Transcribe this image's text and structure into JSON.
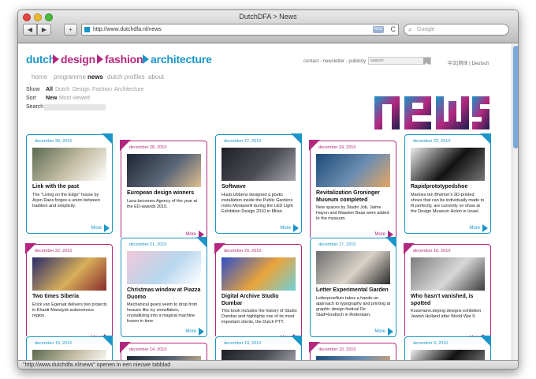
{
  "browser": {
    "window_title": "DutchDFA > News",
    "back": "◀",
    "forward": "▶",
    "add": "+",
    "url": "http://www.dutchdfa.nl/news",
    "rss": "RSS",
    "reload": "C",
    "search_placeholder": "Google",
    "status": "\"http://www.dutchdfa.nl/news\" openen in een nieuwe tabblad"
  },
  "site": {
    "sections": [
      {
        "label": "dutch",
        "color": "#1a95c8"
      },
      {
        "label": "design",
        "color": "#b3287f"
      },
      {
        "label": "fashion",
        "color": "#b3287f"
      },
      {
        "label": "architecture",
        "color": "#1a95c8"
      }
    ],
    "top_links": "contact - newsletter - publicity",
    "search_placeholder": "search",
    "lang_links": "中文|简体 | Deutsch",
    "nav": [
      "home",
      "programme",
      "news",
      "dutch profiles",
      "about"
    ],
    "nav_active": "news",
    "show_label": "Show",
    "show_options": [
      "All",
      "Dutch",
      "Design",
      "Fashion",
      "Architecture"
    ],
    "sort_label": "Sort",
    "sort_options": [
      "New",
      "Most viewed"
    ],
    "search_label": "Search",
    "logo_text": "news"
  },
  "colors": {
    "blue": "#1a95c8",
    "magenta": "#b3287f"
  },
  "cards": [
    {
      "date": "december 30, 2010",
      "title": "Link with the past",
      "body": "The \"Living on the Edge\" house by Arjen Raes forges a union between tradition and simplicity.",
      "more": "More"
    },
    {
      "date": "december 28, 2010",
      "title": "European design winners",
      "body": "Lava becomes Agency of the year at the ED-awards 2010.",
      "more": "More"
    },
    {
      "date": "december 27, 2010",
      "title": "Softwave",
      "body": "Huub Ubbens designed a poetic installation inside the Public Gardens Indro Montanelli during the LED Light Exhibition Design 2010 in Milan.",
      "more": "More"
    },
    {
      "date": "december 24, 2010",
      "title": "Revitalization Groninger Museum completed",
      "body": "New spaces by Studio Job, Jaime Hayon and Maarten Baas were added to the museum.",
      "more": "More"
    },
    {
      "date": "december 23, 2010",
      "title": "Rapidprototypedshoe",
      "body": "Marloes ten Bhömer's 3D-printed shoes that can be individually made to fit perfectly, are currently on show at the Design Museum Holon in Israel.",
      "more": "More"
    },
    {
      "date": "december 22, 2010",
      "title": "Two times Siberia",
      "body": "Erick van Egeraat delivers two projects in Khanti-Mansiysk autonomous region.",
      "more": "More"
    },
    {
      "date": "december 21, 2010",
      "title": "Christmas window at Piazza Duomo",
      "body": "Mechanical gears seem to drop from heaven like icy snowflakes, crystallizing into a magical machine frozen in time.",
      "more": "More"
    },
    {
      "date": "december 20, 2010",
      "title": "Digital Archive Studio Dumbar",
      "body": "This book includes the history of Studio Dumbar and highlights one of its most important clients, the Dutch PTT.",
      "more": "More"
    },
    {
      "date": "december 17, 2010",
      "title": "Letter Experimental Garden",
      "body": "Letterproeftuin takes a hands-on approach to typography and printing at graphic design festival De Stad=Grafisch in Rotterdam.",
      "more": "More"
    },
    {
      "date": "december 16, 2010",
      "title": "Who hasn't vanished, is spotted",
      "body": "Kossmann.dejong designs exhibition Jewish Holland after World War II.",
      "more": "More"
    },
    {
      "date": "december 15, 2010"
    },
    {
      "date": "december 14, 2010"
    },
    {
      "date": "december 13, 2010"
    },
    {
      "date": "december 10, 2010"
    },
    {
      "date": "december 9, 2010"
    }
  ]
}
